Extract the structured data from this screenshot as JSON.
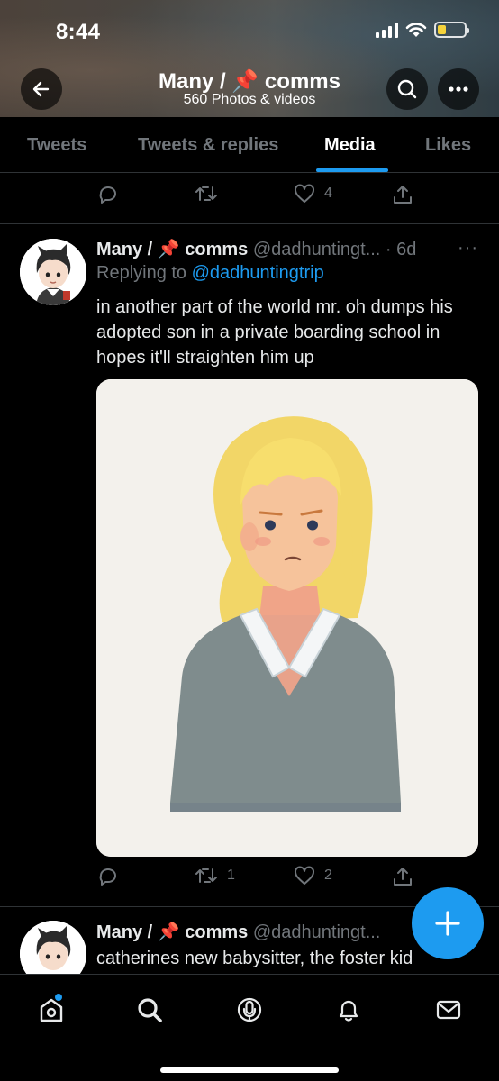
{
  "status_bar": {
    "time": "8:44"
  },
  "header": {
    "title": "Many / 📌 comms",
    "subtitle": "560 Photos & videos"
  },
  "tabs": [
    {
      "label": "Tweets"
    },
    {
      "label": "Tweets & replies"
    },
    {
      "label": "Media"
    },
    {
      "label": "Likes"
    }
  ],
  "active_tab": "Media",
  "prev_tweet": {
    "reply_count": "",
    "retweet_count": "",
    "like_count": "4"
  },
  "tweets": [
    {
      "name": "Many / 📌 comms",
      "handle": "@dadhuntingt...",
      "time": "· 6d",
      "replying_prefix": "Replying to",
      "replying_to": "@dadhuntingtrip",
      "text": "in another part of the world mr. oh dumps his adopted son in a private boarding school in hopes it'll straighten him up",
      "retweet_count": "1",
      "like_count": "2"
    },
    {
      "name": "Many / 📌 comms",
      "handle": "@dadhuntingt...",
      "text": "catherines new babysitter, the foster kid"
    }
  ],
  "more_glyph": "···",
  "colors": {
    "accent": "#1d9bf0",
    "background": "#000000",
    "muted": "#71767b"
  },
  "icons": [
    "back-arrow-icon",
    "search-icon",
    "more-icon",
    "reply-icon",
    "retweet-icon",
    "like-icon",
    "share-icon",
    "compose-plus-icon",
    "home-icon",
    "explore-icon",
    "spaces-icon",
    "notifications-icon",
    "messages-icon"
  ]
}
